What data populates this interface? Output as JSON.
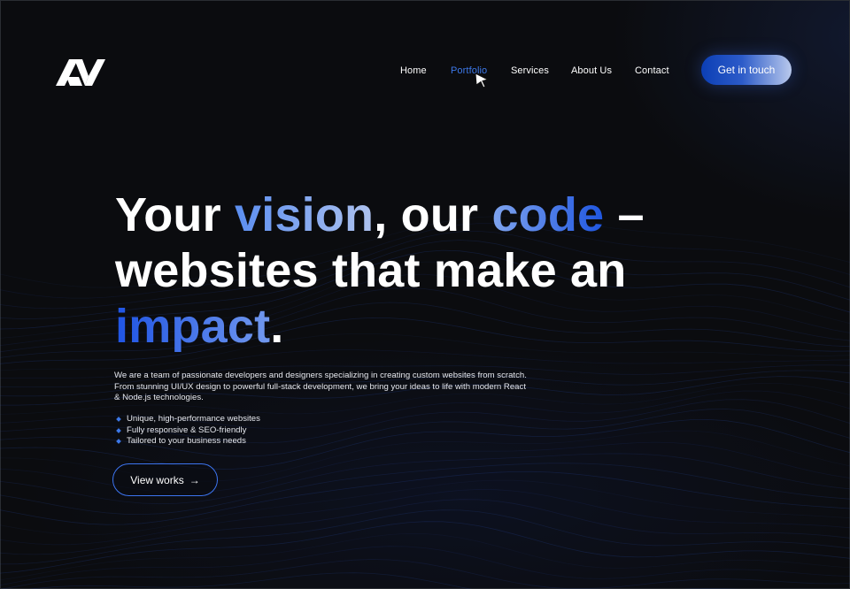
{
  "brand": {
    "logo_icon": "av-monogram-logo"
  },
  "nav": {
    "items": [
      {
        "label": "Home",
        "active": false
      },
      {
        "label": "Portfolio",
        "active": true
      },
      {
        "label": "Services",
        "active": false
      },
      {
        "label": "About Us",
        "active": false
      },
      {
        "label": "Contact",
        "active": false
      }
    ],
    "cta_label": "Get in touch"
  },
  "hero": {
    "headline": {
      "w1": "Your ",
      "w2": "vision",
      "w3": ", our ",
      "w4": "code",
      "w5": " –",
      "line2": "websites that make an",
      "w6": "impact",
      "w7": "."
    },
    "description": "We are a team of passionate developers and designers specializing in creating custom websites from scratch. From stunning UI/UX design to powerful full-stack development, we bring your ideas to life with modern React & Node.js technologies.",
    "features": [
      "Unique, high-performance websites",
      "Fully responsive & SEO-friendly",
      "Tailored to your business needs"
    ],
    "button_label": "View works",
    "button_arrow": "→"
  },
  "colors": {
    "background": "#0b0c0f",
    "accent": "#3c78e8",
    "accent_dark": "#1f54e4",
    "text": "#ffffff"
  }
}
